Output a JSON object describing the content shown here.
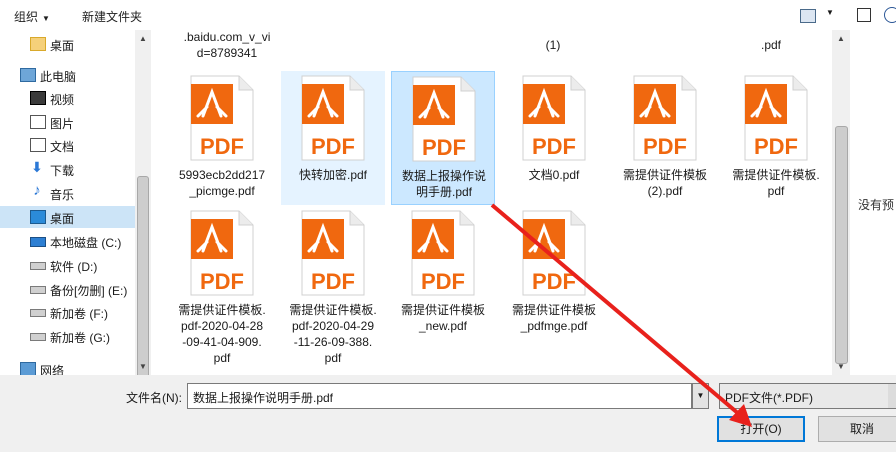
{
  "toolbar": {
    "organize": "组织",
    "new_folder": "新建文件夹"
  },
  "nav": {
    "items": [
      {
        "label": "桌面",
        "icon": "folder-icon"
      },
      {
        "label": "此电脑",
        "icon": "computer-icon"
      },
      {
        "label": "视频",
        "icon": "video-icon"
      },
      {
        "label": "图片",
        "icon": "picture-icon"
      },
      {
        "label": "文档",
        "icon": "document-icon"
      },
      {
        "label": "下载",
        "icon": "download-icon"
      },
      {
        "label": "音乐",
        "icon": "music-icon"
      },
      {
        "label": "桌面",
        "icon": "desktop-icon"
      },
      {
        "label": "本地磁盘 (C:)",
        "icon": "os-drive-icon"
      },
      {
        "label": "软件 (D:)",
        "icon": "drive-icon"
      },
      {
        "label": "备份[勿删] (E:)",
        "icon": "drive-icon"
      },
      {
        "label": "新加卷 (F:)",
        "icon": "drive-icon"
      },
      {
        "label": "新加卷 (G:)",
        "icon": "drive-icon"
      },
      {
        "label": "网络",
        "icon": "network-icon"
      }
    ]
  },
  "files": {
    "top_partial": [
      ".baidu.com_v_vi\nd=8789341",
      "(1)",
      ".pdf"
    ],
    "items": [
      {
        "name": "5993ecb2dd217\n_picmge.pdf"
      },
      {
        "name": "快转加密.pdf"
      },
      {
        "name": "数据上报操作说\n明手册.pdf"
      },
      {
        "name": "文档0.pdf"
      },
      {
        "name": "需提供证件模板\n(2).pdf"
      },
      {
        "name": "需提供证件模板.\npdf"
      },
      {
        "name": "需提供证件模板.\npdf-2020-04-28\n-09-41-04-909.\npdf"
      },
      {
        "name": "需提供证件模板.\npdf-2020-04-29\n-11-26-09-388.\npdf"
      },
      {
        "name": "需提供证件模板\n_new.pdf"
      },
      {
        "name": "需提供证件模板\n_pdfmge.pdf"
      }
    ],
    "pdf_badge": "PDF"
  },
  "preview": {
    "text": "没有预"
  },
  "bottom": {
    "filename_label": "文件名(N):",
    "filename_value": "数据上报操作说明手册.pdf",
    "filter_value": "PDF文件(*.PDF)",
    "open_label": "打开(O)",
    "cancel_label": "取消"
  },
  "colors": {
    "pdf_orange": "#f0680f",
    "selection": "#cce8ff",
    "annotation_arrow": "#e8211c"
  }
}
